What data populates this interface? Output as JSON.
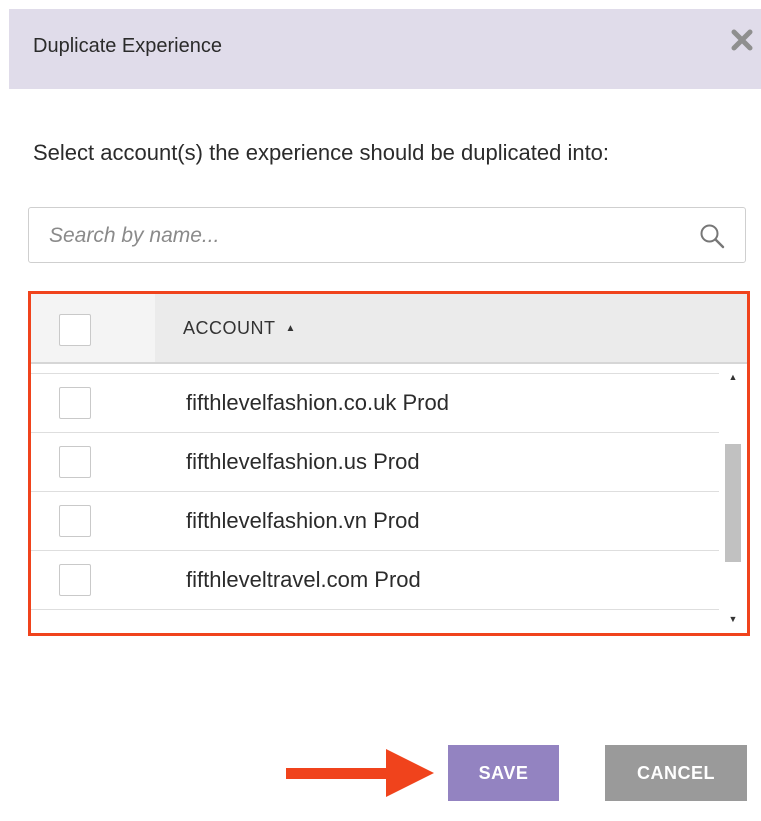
{
  "dialog": {
    "title": "Duplicate Experience",
    "prompt": "Select account(s) the experience should be duplicated into:"
  },
  "search": {
    "placeholder": "Search by name...",
    "value": ""
  },
  "table": {
    "column_header": "ACCOUNT",
    "sort_direction": "ascending",
    "rows": [
      {
        "label": "fifthlevelfashion.co.uk Prod",
        "checked": false
      },
      {
        "label": "fifthlevelfashion.us Prod",
        "checked": false
      },
      {
        "label": "fifthlevelfashion.vn Prod",
        "checked": false
      },
      {
        "label": "fifthleveltravel.com Prod",
        "checked": false
      }
    ]
  },
  "footer": {
    "save_label": "SAVE",
    "cancel_label": "CANCEL"
  },
  "colors": {
    "header_bg": "#e0dcea",
    "highlight_border": "#f0431c",
    "save_button": "#9383c1",
    "cancel_button": "#9a9a9a",
    "annotation_arrow": "#f0431c"
  },
  "icons": {
    "close": "close-icon",
    "search": "search-icon",
    "sort": "sort-ascending-icon",
    "annotation": "arrow-right-icon"
  }
}
